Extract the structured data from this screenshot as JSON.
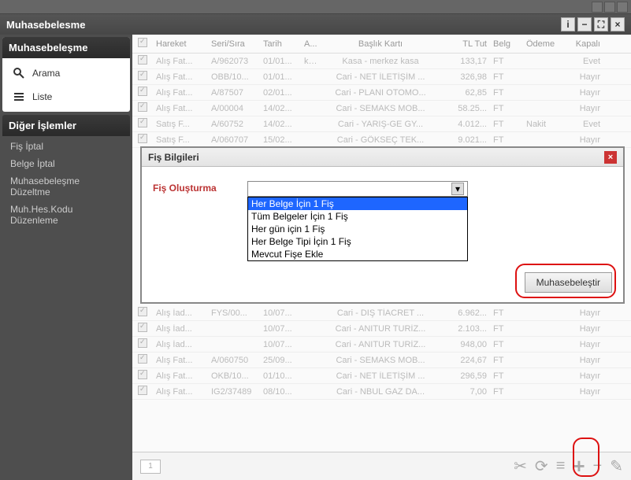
{
  "window_title": "Muhasebelesme",
  "sidebar": {
    "panel1_title": "Muhasebeleşme",
    "arama": "Arama",
    "liste": "Liste",
    "panel2_title": "Diğer İşlemler",
    "items": [
      "Fiş İptal",
      "Belge İptal",
      "Muhasebeleşme Düzeltme",
      "Muh.Hes.Kodu Düzenleme"
    ]
  },
  "grid": {
    "cols": [
      "",
      "Hareket",
      "Seri/Sıra",
      "Tarih",
      "A...",
      "Başlık Kartı",
      "TL Tut",
      "Belg",
      "Ödeme",
      "Kapalı"
    ],
    "rows": [
      {
        "h": "Alış Fat...",
        "s": "A/962073",
        "t": "01/01...",
        "a": "k...",
        "b": "Kasa - merkez kasa",
        "tl": "133,17",
        "bg": "FT",
        "o": "",
        "k": "Evet"
      },
      {
        "h": "Alış Fat...",
        "s": "OBB/10...",
        "t": "01/01...",
        "a": "",
        "b": "Cari - NET İLETİŞİM ...",
        "tl": "326,98",
        "bg": "FT",
        "o": "",
        "k": "Hayır"
      },
      {
        "h": "Alış Fat...",
        "s": "A/87507",
        "t": "02/01...",
        "a": "",
        "b": "Cari - PLANI OTOMO...",
        "tl": "62,85",
        "bg": "FT",
        "o": "",
        "k": "Hayır"
      },
      {
        "h": "Alış Fat...",
        "s": "A/00004",
        "t": "14/02...",
        "a": "",
        "b": "Cari - SEMAKS MOB...",
        "tl": "58.25...",
        "bg": "FT",
        "o": "",
        "k": "Hayır"
      },
      {
        "h": "Satış F...",
        "s": "A/60752",
        "t": "14/02...",
        "a": "",
        "b": "Cari - YARIŞ-GE GY...",
        "tl": "4.012...",
        "bg": "FT",
        "o": "Nakit",
        "k": "Evet"
      },
      {
        "h": "Satış F...",
        "s": "A/060707",
        "t": "15/02...",
        "a": "",
        "b": "Cari - GÖKSEÇ TEK...",
        "tl": "9.021...",
        "bg": "FT",
        "o": "",
        "k": "Hayır"
      },
      {
        "h": "Alış İad...",
        "s": "FYS/00...",
        "t": "10/07...",
        "a": "",
        "b": "Cari - DIŞ TİACRET ...",
        "tl": "6.962...",
        "bg": "FT",
        "o": "",
        "k": "Hayır"
      },
      {
        "h": "Alış İad...",
        "s": "",
        "t": "10/07...",
        "a": "",
        "b": "Cari - ANITUR TURİZ...",
        "tl": "2.103...",
        "bg": "FT",
        "o": "",
        "k": "Hayır"
      },
      {
        "h": "Alış İad...",
        "s": "",
        "t": "10/07...",
        "a": "",
        "b": "Cari - ANITUR TURİZ...",
        "tl": "948,00",
        "bg": "FT",
        "o": "",
        "k": "Hayır"
      },
      {
        "h": "Alış Fat...",
        "s": "A/060750",
        "t": "25/09...",
        "a": "",
        "b": "Cari - SEMAKS MOB...",
        "tl": "224,67",
        "bg": "FT",
        "o": "",
        "k": "Hayır"
      },
      {
        "h": "Alış Fat...",
        "s": "OKB/10...",
        "t": "01/10...",
        "a": "",
        "b": "Cari - NET İLETİŞİM ...",
        "tl": "296,59",
        "bg": "FT",
        "o": "",
        "k": "Hayır"
      },
      {
        "h": "Alış Fat...",
        "s": "IG2/37489",
        "t": "08/10...",
        "a": "",
        "b": "Cari - NBUL GAZ DA...",
        "tl": "7,00",
        "bg": "FT",
        "o": "",
        "k": "Hayır"
      }
    ]
  },
  "modal": {
    "title": "Fiş Bilgileri",
    "label": "Fiş Oluşturma",
    "options": [
      "Her Belge İçin 1 Fiş",
      "Tüm Belgeler İçin 1 Fiş",
      "Her gün için 1 Fiş",
      "Her Belge Tipi İçin 1 Fiş",
      "Mevcut Fişe Ekle"
    ],
    "button": "Muhasebeleştir"
  },
  "footer": {
    "page": "1"
  }
}
